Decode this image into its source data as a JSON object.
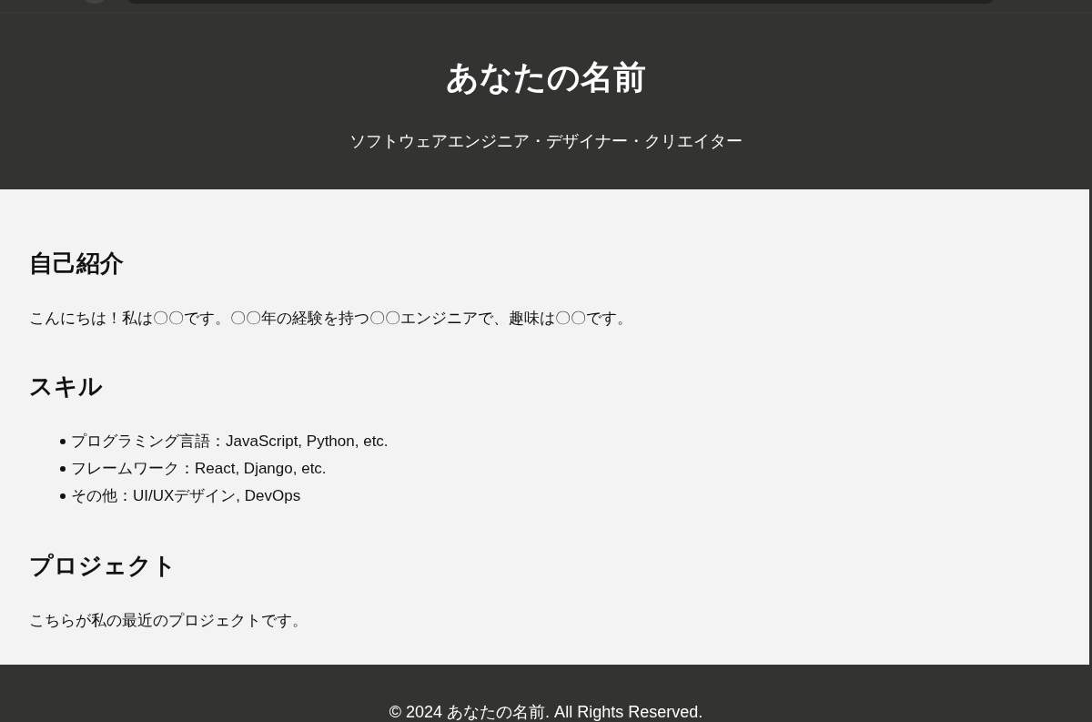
{
  "header": {
    "title": "あなたの名前",
    "subtitle": "ソフトウェアエンジニア・デザイナー・クリエイター"
  },
  "sections": [
    {
      "kind": "text",
      "heading": "自己紹介",
      "text": "こんにちは！私は〇〇です。〇〇年の経験を持つ〇〇エンジニアで、趣味は〇〇です。"
    },
    {
      "kind": "list",
      "heading": "スキル",
      "items": [
        "プログラミング言語：JavaScript, Python, etc.",
        "フレームワーク：React, Django, etc.",
        "その他：UI/UXデザイン, DevOps"
      ]
    },
    {
      "kind": "text",
      "heading": "プロジェクト",
      "text": "こちらが私の最近のプロジェクトです。"
    }
  ],
  "footer": {
    "text": "© 2024 あなたの名前. All Rights Reserved."
  }
}
